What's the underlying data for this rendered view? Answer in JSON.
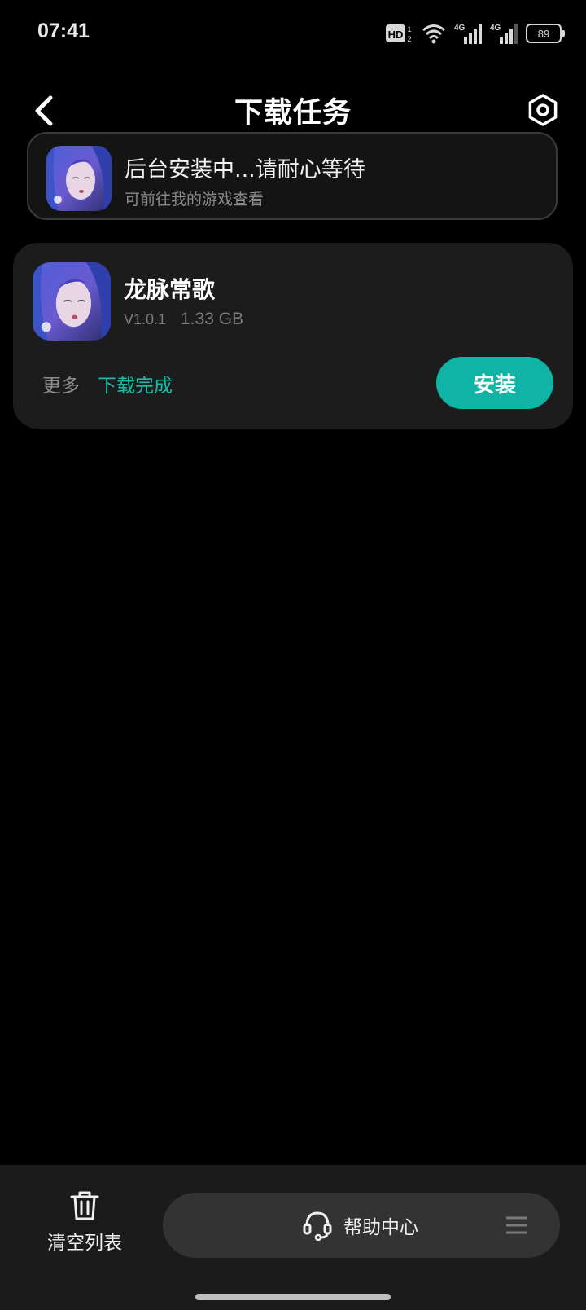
{
  "status_bar": {
    "time": "07:41",
    "battery": "89",
    "hd_label": "HD",
    "network_1": "4G",
    "network_2": "4G"
  },
  "header": {
    "title": "下载任务"
  },
  "banner": {
    "title": "后台安装中...请耐心等待",
    "subtitle": "可前往我的游戏查看"
  },
  "download_item": {
    "name": "龙脉常歌",
    "version": "V1.0.1",
    "size": "1.33 GB",
    "more_label": "更多",
    "status": "下载完成",
    "install_label": "安装"
  },
  "bottom_bar": {
    "clear_label": "清空列表",
    "help_label": "帮助中心"
  },
  "colors": {
    "accent": "#0fb4a4",
    "status_text": "#1fb9a9",
    "background": "#000000",
    "card": "#1c1c1c"
  }
}
